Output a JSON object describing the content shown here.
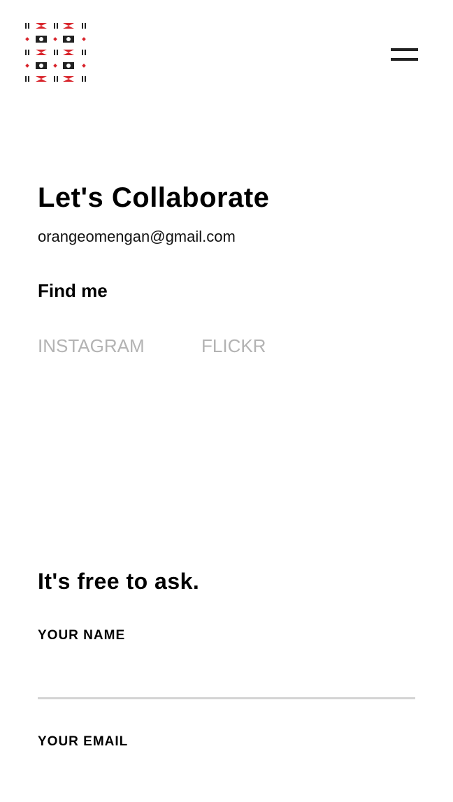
{
  "header": {
    "logo_icon": "camera-pattern-logo-icon",
    "menu_icon": "hamburger-menu-icon"
  },
  "contact": {
    "title": "Let's Collaborate",
    "email": "orangeomengan@gmail.com",
    "find_heading": "Find me",
    "social": [
      {
        "label": "INSTAGRAM"
      },
      {
        "label": "FLICKR"
      }
    ]
  },
  "form": {
    "heading": "It's free to ask.",
    "name_label": "YOUR NAME",
    "name_value": "",
    "email_label": "YOUR EMAIL",
    "email_value": ""
  },
  "colors": {
    "accent_red": "#d8232a",
    "text": "#000000",
    "muted_link": "#b3b3b3",
    "divider": "#d4d4d4"
  }
}
